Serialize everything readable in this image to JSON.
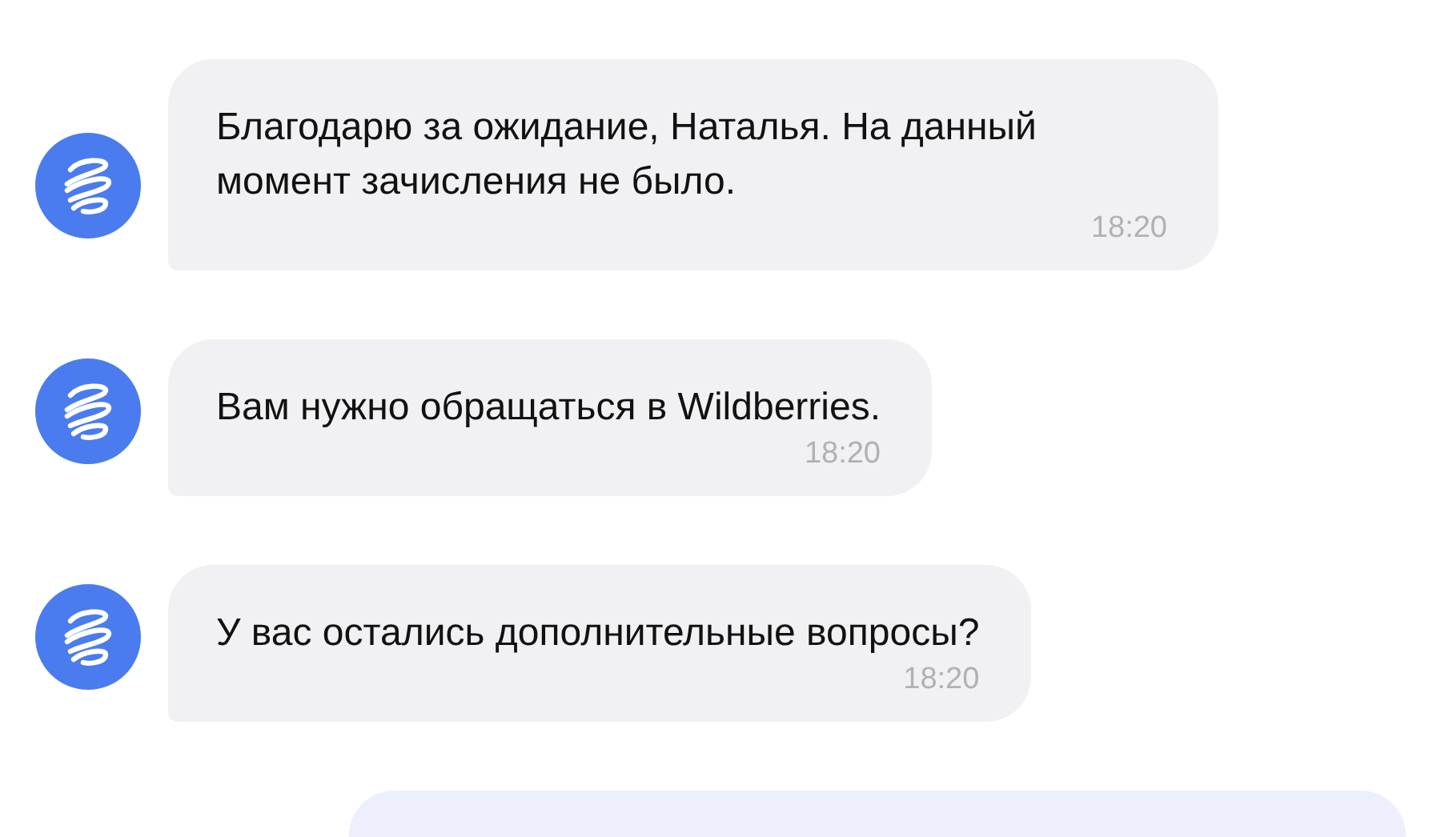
{
  "messages": [
    {
      "kind": "incoming",
      "text": "Благодарю за ожидание, Наталья. На данный момент зачисления не было.",
      "time": "18:20"
    },
    {
      "kind": "incoming",
      "text": "Вам нужно обращаться в Wildberries.",
      "time": "18:20"
    },
    {
      "kind": "incoming",
      "text": "У вас остались дополнительные вопросы?",
      "time": "18:20"
    },
    {
      "kind": "outgoing"
    }
  ]
}
